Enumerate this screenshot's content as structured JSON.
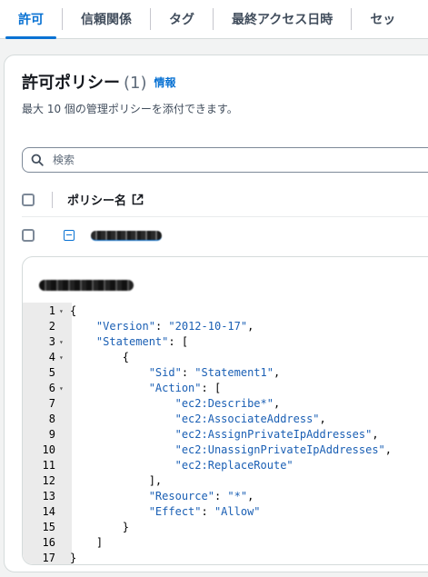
{
  "tabs": [
    {
      "label": "許可",
      "active": true
    },
    {
      "label": "信頼関係",
      "active": false
    },
    {
      "label": "タグ",
      "active": false
    },
    {
      "label": "最終アクセス日時",
      "active": false
    },
    {
      "label": "セッ",
      "active": false
    }
  ],
  "panel": {
    "title": "許可ポリシー",
    "count": "(1)",
    "info_link": "情報",
    "description": "最大 10 個の管理ポリシーを添付できます。"
  },
  "search": {
    "placeholder": "検索"
  },
  "table": {
    "column_name": "ポリシー名"
  },
  "code_lines": [
    {
      "n": "1",
      "fold": true,
      "text": "{"
    },
    {
      "n": "2",
      "fold": false,
      "text": "    \"Version\": \"2012-10-17\","
    },
    {
      "n": "3",
      "fold": true,
      "text": "    \"Statement\": ["
    },
    {
      "n": "4",
      "fold": true,
      "text": "        {"
    },
    {
      "n": "5",
      "fold": false,
      "text": "            \"Sid\": \"Statement1\","
    },
    {
      "n": "6",
      "fold": true,
      "text": "            \"Action\": ["
    },
    {
      "n": "7",
      "fold": false,
      "text": "                \"ec2:Describe*\","
    },
    {
      "n": "8",
      "fold": false,
      "text": "                \"ec2:AssociateAddress\","
    },
    {
      "n": "9",
      "fold": false,
      "text": "                \"ec2:AssignPrivateIpAddresses\","
    },
    {
      "n": "10",
      "fold": false,
      "text": "                \"ec2:UnassignPrivateIpAddresses\","
    },
    {
      "n": "11",
      "fold": false,
      "text": "                \"ec2:ReplaceRoute\""
    },
    {
      "n": "12",
      "fold": false,
      "text": "            ],"
    },
    {
      "n": "13",
      "fold": false,
      "text": "            \"Resource\": \"*\","
    },
    {
      "n": "14",
      "fold": false,
      "text": "            \"Effect\": \"Allow\""
    },
    {
      "n": "15",
      "fold": false,
      "text": "        }"
    },
    {
      "n": "16",
      "fold": false,
      "text": "    ]"
    },
    {
      "n": "17",
      "fold": false,
      "text": "}"
    }
  ],
  "colors": {
    "accent": "#0972d3",
    "code_key": "#1a5fb4",
    "gutter": "#ebebeb"
  }
}
